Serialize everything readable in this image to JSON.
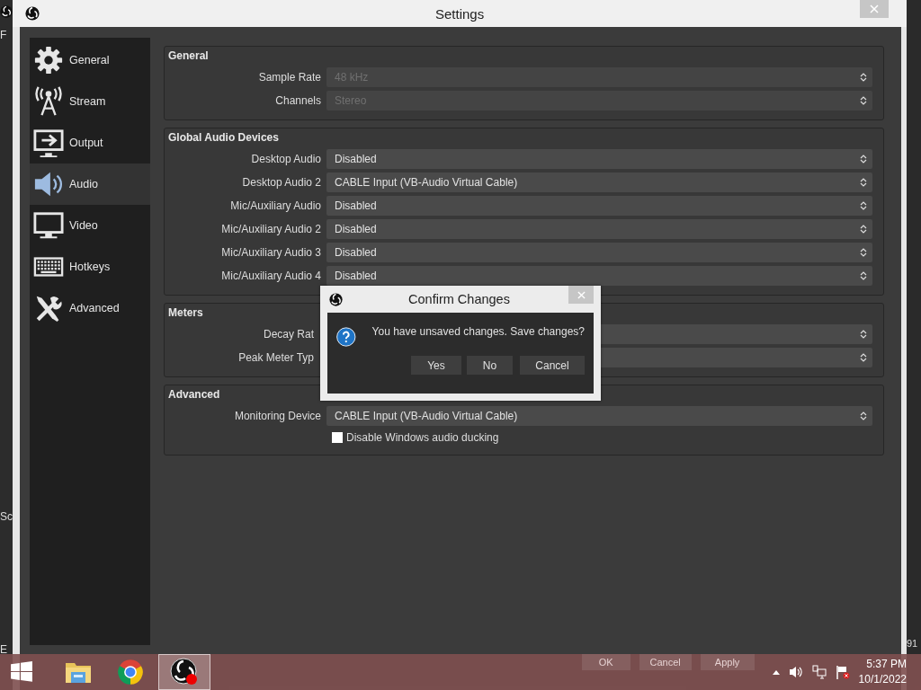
{
  "behind_window": {
    "left_texts": [
      "F",
      "Sc",
      "E"
    ],
    "right_texts": [
      "91"
    ]
  },
  "window": {
    "title": "Settings"
  },
  "sidebar": {
    "items": [
      {
        "label": "General",
        "kind": "gear",
        "selected": false
      },
      {
        "label": "Stream",
        "kind": "antenna",
        "selected": false
      },
      {
        "label": "Output",
        "kind": "output",
        "selected": false
      },
      {
        "label": "Audio",
        "kind": "speaker",
        "selected": true
      },
      {
        "label": "Video",
        "kind": "monitor",
        "selected": false
      },
      {
        "label": "Hotkeys",
        "kind": "keyboard",
        "selected": false
      },
      {
        "label": "Advanced",
        "kind": "tools",
        "selected": false
      }
    ]
  },
  "sections": [
    {
      "title": "General",
      "rows": [
        {
          "kind": "combo",
          "label": "Sample Rate",
          "value": "48 kHz",
          "disabled": true
        },
        {
          "kind": "combo",
          "label": "Channels",
          "value": "Stereo",
          "disabled": true
        }
      ]
    },
    {
      "title": "Global Audio Devices",
      "rows": [
        {
          "kind": "combo",
          "label": "Desktop Audio",
          "value": "Disabled",
          "disabled": false
        },
        {
          "kind": "combo",
          "label": "Desktop Audio 2",
          "value": "CABLE Input (VB-Audio Virtual Cable)",
          "disabled": false
        },
        {
          "kind": "combo",
          "label": "Mic/Auxiliary Audio",
          "value": "Disabled",
          "disabled": false
        },
        {
          "kind": "combo",
          "label": "Mic/Auxiliary Audio 2",
          "value": "Disabled",
          "disabled": false
        },
        {
          "kind": "combo",
          "label": "Mic/Auxiliary Audio 3",
          "value": "Disabled",
          "disabled": false
        },
        {
          "kind": "combo",
          "label": "Mic/Auxiliary Audio 4",
          "value": "Disabled",
          "disabled": false
        }
      ]
    },
    {
      "title": "Meters",
      "rows": [
        {
          "kind": "combo",
          "label": "Decay Rat"
        },
        {
          "kind": "combo",
          "label": "Peak Meter Typ"
        }
      ]
    },
    {
      "title": "Advanced",
      "rows": [
        {
          "kind": "combo",
          "label": "Monitoring Device",
          "value": "CABLE Input (VB-Audio Virtual Cable)",
          "disabled": false
        },
        {
          "kind": "checkbox",
          "label": "Disable Windows audio ducking",
          "checked": false
        }
      ]
    }
  ],
  "footer_buttons": [
    "OK",
    "Cancel",
    "Apply"
  ],
  "dialog": {
    "title": "Confirm Changes",
    "message": "You have unsaved changes. Save changes?",
    "buttons": [
      "Yes",
      "No",
      "Cancel"
    ]
  },
  "taskbar": {
    "apps": [
      {
        "kind": "start",
        "selected": false
      },
      {
        "kind": "folder",
        "selected": false
      },
      {
        "kind": "browser",
        "selected": false
      },
      {
        "kind": "obs",
        "selected": true
      }
    ],
    "time": "5:37 PM",
    "date": "10/1/2022"
  }
}
